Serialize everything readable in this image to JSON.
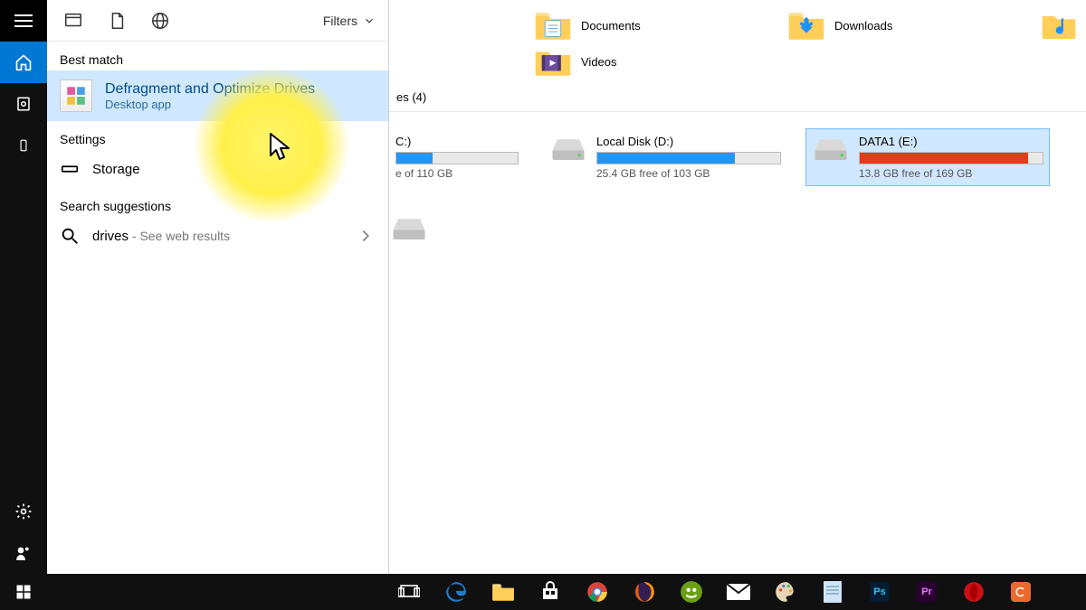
{
  "panel": {
    "filters_label": "Filters",
    "best_match_header": "Best match",
    "best_match": {
      "title": "Defragment and Optimize Drives",
      "subtitle": "Desktop app"
    },
    "settings_header": "Settings",
    "settings_item": "Storage",
    "suggestions_header": "Search suggestions",
    "suggestion_term": "drives",
    "suggestion_tail": " - See web results"
  },
  "search": {
    "value": "drives"
  },
  "explorer": {
    "folders": [
      {
        "name": "Documents",
        "icon": "documents"
      },
      {
        "name": "Downloads",
        "icon": "downloads"
      },
      {
        "name": "Videos",
        "icon": "videos"
      }
    ],
    "devices_header": "es (4)",
    "drives": [
      {
        "label": "C:)",
        "free": "e of 110 GB",
        "fill_pct": 30,
        "color": "blue",
        "selected": false,
        "visible_icon": false
      },
      {
        "label": "Local Disk (D:)",
        "free": "25.4 GB free of 103 GB",
        "fill_pct": 75,
        "color": "blue",
        "selected": false,
        "visible_icon": true
      },
      {
        "label": "DATA1 (E:)",
        "free": "13.8 GB free of 169 GB",
        "fill_pct": 92,
        "color": "red",
        "selected": true,
        "visible_icon": true
      },
      {
        "label": "",
        "free": "",
        "fill_pct": 0,
        "color": "blue",
        "selected": false,
        "visible_icon": true
      }
    ]
  },
  "rail": {
    "items": [
      "home",
      "settings-panel",
      "recent"
    ]
  },
  "taskbar": {
    "apps": [
      "task-view",
      "edge",
      "file-explorer",
      "store",
      "chrome",
      "firefox",
      "app-green",
      "mail",
      "paint",
      "notepad",
      "photoshop",
      "premiere",
      "opera",
      "camtasia"
    ]
  }
}
